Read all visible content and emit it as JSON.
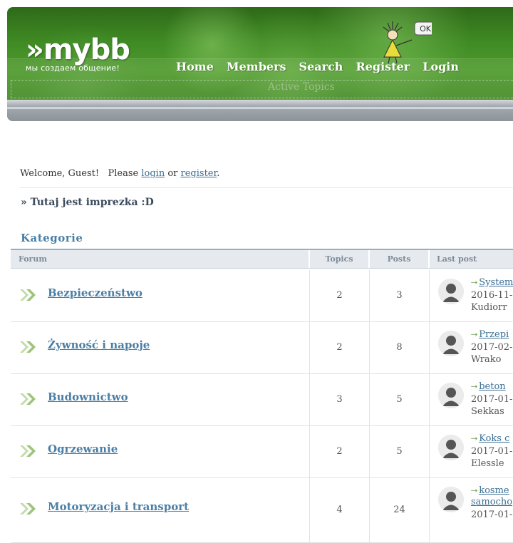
{
  "header": {
    "logo_mark": "»mybb",
    "logo_tagline": "мы создаем общение!",
    "mascot_bubble": "OK",
    "nav": [
      "Home",
      "Members",
      "Search",
      "Register",
      "Login"
    ],
    "active_topics": "Active Topics"
  },
  "welcome": {
    "prefix": "Welcome, Guest!   Please ",
    "login": "login",
    "middle": " or ",
    "register": "register",
    "suffix": "."
  },
  "board_name": "» Tutaj jest imprezka :D",
  "category": "Kategorie",
  "table": {
    "headers": {
      "forum": "Forum",
      "topics": "Topics",
      "posts": "Posts",
      "last_post": "Last post"
    },
    "rows": [
      {
        "name": "Bezpieczeństwo",
        "topics": "2",
        "posts": "3",
        "last_thread": "System",
        "last_date": "2016-11-",
        "last_user": "Kudiorr"
      },
      {
        "name": "Żywność i napoje",
        "topics": "2",
        "posts": "8",
        "last_thread": "Przepi",
        "last_date": "2017-02-",
        "last_user": "Wrako"
      },
      {
        "name": "Budownictwo",
        "topics": "3",
        "posts": "5",
        "last_thread": "beton",
        "last_date": "2017-01-",
        "last_user": "Sekkas"
      },
      {
        "name": "Ogrzewanie",
        "topics": "2",
        "posts": "5",
        "last_thread": "Koks c",
        "last_date": "2017-01-",
        "last_user": "Elessle"
      },
      {
        "name": "Motoryzacja i transport",
        "topics": "4",
        "posts": "24",
        "last_thread": "kosme",
        "last_thread_2": "samocho",
        "last_date": "2017-01-",
        "last_user": ""
      }
    ]
  },
  "colors": {
    "header_green": "#3f8a24",
    "link_blue": "#4b7fa6",
    "header_gray": "#a3aab0"
  }
}
